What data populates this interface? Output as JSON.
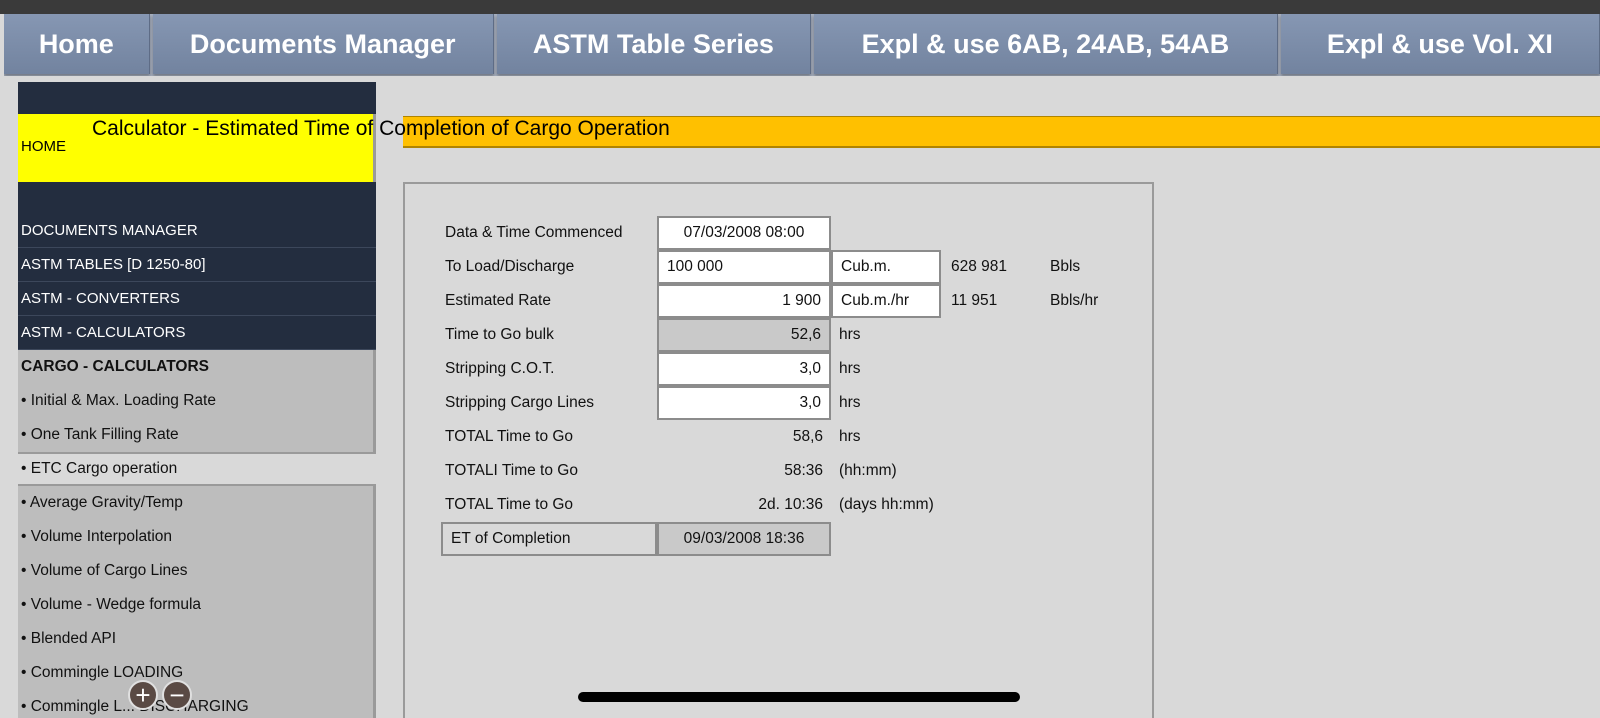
{
  "topnav": {
    "tabs": [
      {
        "label": "Home",
        "width": 146
      },
      {
        "label": "Documents Manager",
        "width": 342
      },
      {
        "label": "ASTM Table Series",
        "width": 315
      },
      {
        "label": "Expl & use 6AB, 24AB, 54AB",
        "width": 465
      },
      {
        "label": "Expl & use Vol. XI",
        "width": 320
      }
    ]
  },
  "page": {
    "title": "Calculator - Estimated Time of Completion of Cargo Operation"
  },
  "sidebar": {
    "home": "HOME",
    "documents_manager": "DOCUMENTS MANAGER",
    "astm_tables": "ASTM TABLES [D 1250-80]",
    "astm_converters": "ASTM - CONVERTERS",
    "astm_calculators": "ASTM - CALCULATORS",
    "cargo_calculators": "CARGO - CALCULATORS",
    "items": [
      "• Initial & Max. Loading Rate",
      "• One Tank Filling Rate",
      "• ETC Cargo operation",
      "• Average Gravity/Temp",
      "• Volume Interpolation",
      "• Volume of Cargo Lines",
      "• Volume - Wedge formula",
      "• Blended API",
      "• Commingle LOADING",
      "• Commingle L... DISCHARGING"
    ]
  },
  "calc": {
    "commenced_label": "Data & Time Commenced",
    "commenced_value": "07/03/2008 08:00",
    "load_label": "To Load/Discharge",
    "load_value": "100 000",
    "load_unit": "Cub.m.",
    "load_bbls": "628 981",
    "load_bbls_unit": "Bbls",
    "rate_label": "Estimated Rate",
    "rate_value": "1 900",
    "rate_unit": "Cub.m./hr",
    "rate_bbls": "11 951",
    "rate_bbls_unit": "Bbls/hr",
    "bulk_label": "Time to Go bulk",
    "bulk_value": "52,6",
    "cot_label": "Stripping C.O.T.",
    "cot_value": "3,0",
    "lines_label": "Stripping Cargo Lines",
    "lines_value": "3,0",
    "total_label": "TOTAL Time to Go",
    "total_value": "58,6",
    "total2_label": "TOTALI Time to Go",
    "total2_value": "58:36",
    "total2_unit": "(hh:mm)",
    "total3_label": "TOTAL Time to Go",
    "total3_value": "2d. 10:36",
    "total3_unit": "(days hh:mm)",
    "hrs": "hrs",
    "etc_label": "ET of Completion",
    "etc_value": "09/03/2008 18:36"
  },
  "zoom": {
    "plus": "+",
    "minus": "−"
  }
}
